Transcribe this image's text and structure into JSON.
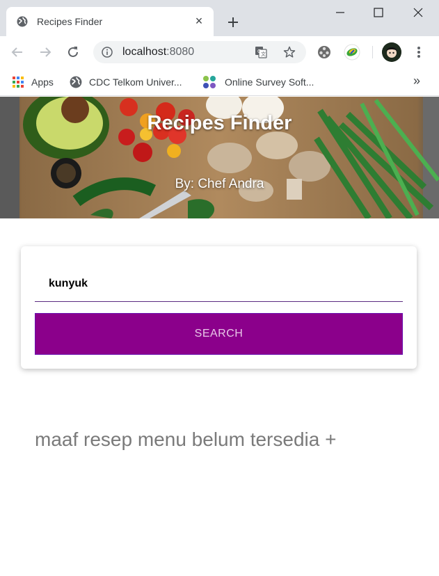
{
  "browser": {
    "tab": {
      "title": "Recipes Finder",
      "close_glyph": "×"
    },
    "address": {
      "host": "localhost",
      "port": ":8080"
    },
    "bookmarks": [
      {
        "label": "Apps",
        "icon": "apps-grid-icon"
      },
      {
        "label": "CDC Telkom Univer...",
        "icon": "globe-icon"
      },
      {
        "label": "Online Survey Soft...",
        "icon": "survey-logo-icon"
      }
    ],
    "bookmarks_more": "»"
  },
  "hero": {
    "title": "Recipes Finder",
    "subtitle": "By: Chef Andra"
  },
  "search": {
    "value": "kunyuk",
    "button_label": "SEARCH"
  },
  "message": "maaf resep menu belum tersedia +",
  "colors": {
    "accent": "#8b008b",
    "underline": "#5a2a80",
    "message_text": "#7a7a7a"
  }
}
